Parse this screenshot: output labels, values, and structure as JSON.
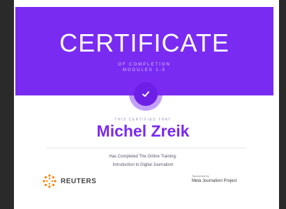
{
  "certificate": {
    "title": "CERTIFICATE",
    "subtitle": "OF COMPLETION",
    "modules": "MODULES 1-5",
    "certifies_label": "THIS CERTIFIES THAT",
    "recipient_name": "Michel Zreik",
    "completed_line1": "Has Completed The Online Training:",
    "completed_line2": "Introduction to Digital Journalism"
  },
  "logos": {
    "reuters": "REUTERS",
    "sponsored_by": "Sponsored by",
    "sponsor_name": "Meta Journalism Project"
  },
  "colors": {
    "accent": "#7a2bf2",
    "frame": "#2a2a2a",
    "reuters_orange": "#ff8000"
  },
  "icons": {
    "badge": "check-icon",
    "reuters_logo": "reuters-dots-icon"
  }
}
